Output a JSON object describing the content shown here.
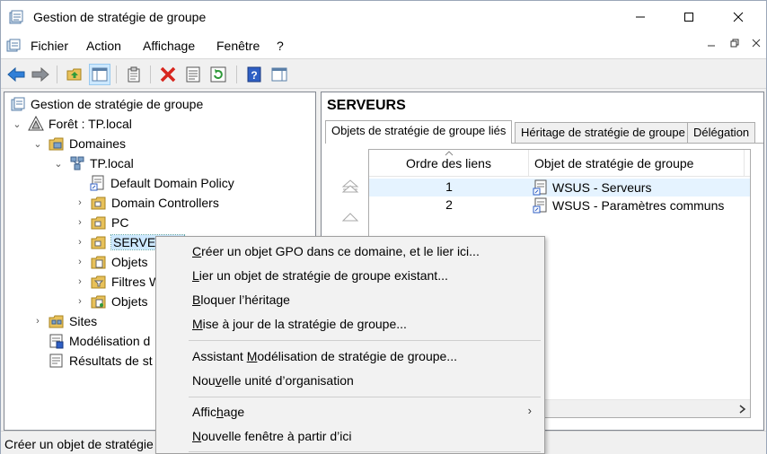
{
  "window": {
    "title": "Gestion de stratégie de groupe"
  },
  "menubar": {
    "items": [
      "Fichier",
      "Action",
      "Affichage",
      "Fenêtre",
      "?"
    ]
  },
  "tree": {
    "root": "Gestion de stratégie de groupe",
    "forest": "Forêt : TP.local",
    "domains": "Domaines",
    "domain": "TP.local",
    "default_policy": "Default Domain Policy",
    "domain_controllers": "Domain Controllers",
    "pc": "PC",
    "serveurs": "SERVEURS",
    "objets1": "Objets",
    "filtres": "Filtres W",
    "objets2": "Objets",
    "sites": "Sites",
    "modelisation": "Modélisation d",
    "resultats": "Résultats de st"
  },
  "right": {
    "ou_title": "SERVEURS",
    "tabs": [
      "Objets de stratégie de groupe liés",
      "Héritage de stratégie de groupe",
      "Délégation"
    ],
    "columns": [
      "Ordre des liens",
      "Objet de stratégie de groupe"
    ],
    "rows": [
      {
        "order": "1",
        "gpo": "WSUS - Serveurs"
      },
      {
        "order": "2",
        "gpo": "WSUS - Paramètres communs"
      }
    ]
  },
  "status": {
    "text": "Créer un objet de stratégie"
  },
  "context_menu": {
    "items": [
      {
        "pre": "",
        "key": "C",
        "post": "réer un objet GPO dans ce domaine, et le lier ici..."
      },
      {
        "pre": "",
        "key": "L",
        "post": "ier un objet de stratégie de groupe existant..."
      },
      {
        "pre": "",
        "key": "B",
        "post": "loquer l’héritage"
      },
      {
        "pre": "",
        "key": "M",
        "post": "ise à jour de la stratégie de groupe..."
      },
      {
        "pre": "Assistant ",
        "key": "M",
        "post": "odélisation de stratégie de groupe..."
      },
      {
        "pre": "Nou",
        "key": "v",
        "post": "elle unité d’organisation"
      },
      {
        "pre": "Affic",
        "key": "h",
        "post": "age"
      },
      {
        "pre": "",
        "key": "N",
        "post": "ouvelle fenêtre à partir d’ici"
      }
    ]
  },
  "colors": {
    "selection": "#cce8ff",
    "row_highlight": "#e5f3ff",
    "folder": "#e8c15a"
  }
}
